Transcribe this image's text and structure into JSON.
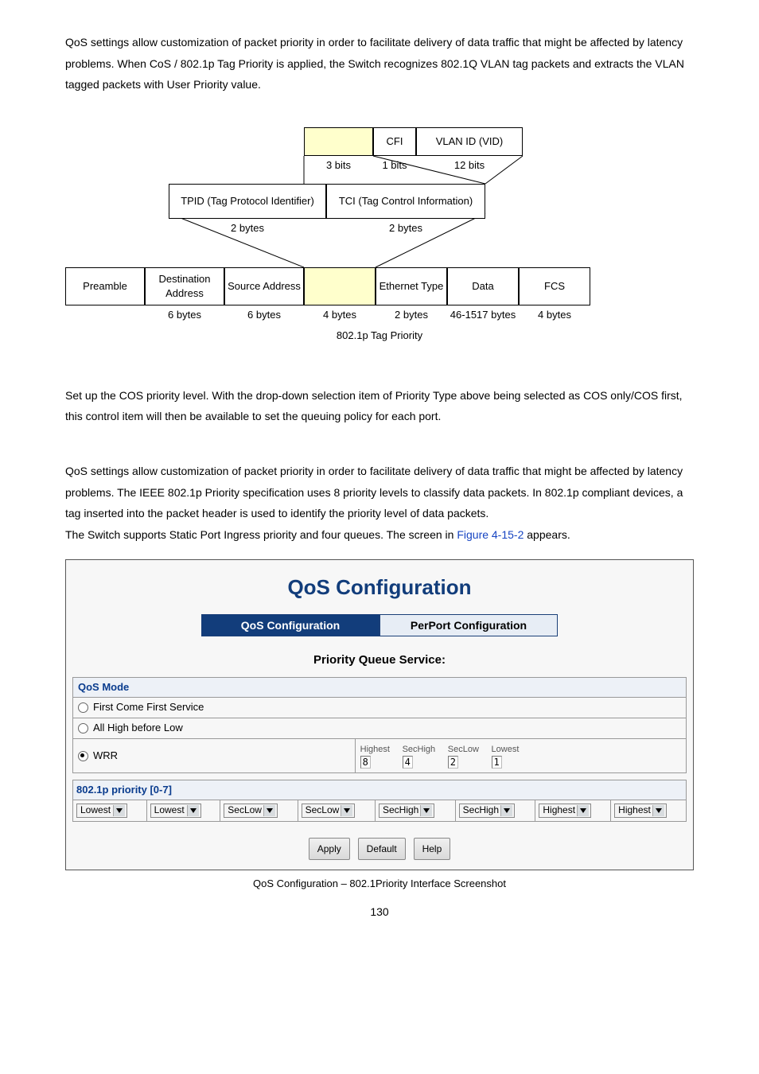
{
  "intro_p1": "QoS settings allow customization of packet priority in order to facilitate delivery of data traffic that might be affected by latency problems. When CoS / 802.1p Tag Priority is applied, the Switch recognizes 802.1Q VLAN tag packets and extracts the VLAN tagged packets with User Priority value.",
  "diagram": {
    "row1": {
      "cfi": "CFI",
      "vid": "VLAN ID (VID)"
    },
    "row1_bits": {
      "a": "3 bits",
      "b": "1 bits",
      "c": "12 bits"
    },
    "row2": {
      "tpid": "TPID (Tag Protocol Identifier)",
      "tci": "TCI (Tag Control Information)"
    },
    "row2_bytes": {
      "a": "2 bytes",
      "b": "2 bytes"
    },
    "row3": {
      "preamble": "Preamble",
      "da": "Destination Address",
      "sa": "Source Address",
      "et": "Ethernet Type",
      "data": "Data",
      "fcs": "FCS"
    },
    "row3_bytes": {
      "da": "6 bytes",
      "sa": "6 bytes",
      "tag": "4 bytes",
      "et": "2 bytes",
      "data": "46-1517 bytes",
      "fcs": "4 bytes"
    },
    "caption": "802.1p Tag Priority"
  },
  "mid_p1": "Set up the COS priority level. With the drop-down selection item of Priority Type above being selected as COS only/COS first, this control item will then be available to set the queuing policy for each port.",
  "mid_p2": "QoS settings allow customization of packet priority in order to facilitate delivery of data traffic that might be affected by latency problems. The IEEE 802.1p Priority specification uses 8 priority levels to classify data packets. In 802.1p compliant devices, a tag inserted into the packet header is used to identify the priority level of data packets.",
  "mid_p3_a": "The Switch supports Static Port Ingress priority and four queues. The screen in ",
  "mid_p3_link": "Figure 4-15-2",
  "mid_p3_b": " appears.",
  "screenshot": {
    "title": "QoS Configuration",
    "tab_active": "QoS Configuration",
    "tab_inactive": "PerPort Configuration",
    "subhead": "Priority Queue Service:",
    "mode_label": "QoS Mode",
    "radio1": "First Come First Service",
    "radio2": "All High before Low",
    "radio3": "WRR",
    "wrr": [
      {
        "lbl": "Highest",
        "val": "8"
      },
      {
        "lbl": "SecHigh",
        "val": "4"
      },
      {
        "lbl": "SecLow",
        "val": "2"
      },
      {
        "lbl": "Lowest",
        "val": "1"
      }
    ],
    "prio_header": "802.1p priority [0-7]",
    "prio": [
      "Lowest",
      "Lowest",
      "SecLow",
      "SecLow",
      "SecHigh",
      "SecHigh",
      "Highest",
      "Highest"
    ],
    "buttons": {
      "apply": "Apply",
      "default": "Default",
      "help": "Help"
    }
  },
  "caption": "QoS Configuration – 802.1Priority Interface Screenshot",
  "pagenum": "130"
}
